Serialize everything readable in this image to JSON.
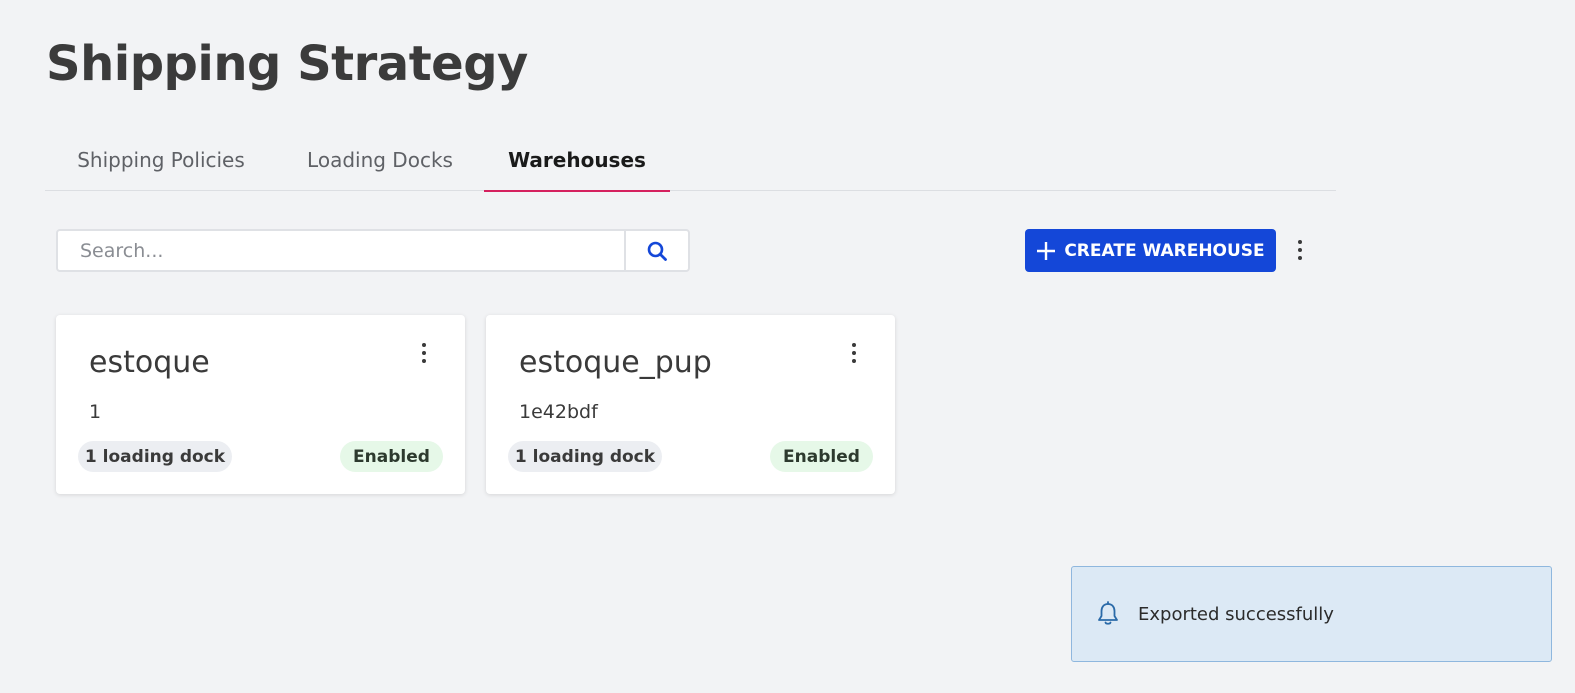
{
  "page": {
    "title": "Shipping Strategy"
  },
  "tabs": [
    {
      "label": "Shipping Policies",
      "active": false
    },
    {
      "label": "Loading Docks",
      "active": false
    },
    {
      "label": "Warehouses",
      "active": true
    }
  ],
  "toolbar": {
    "search_placeholder": "Search...",
    "create_label": "CREATE WAREHOUSE"
  },
  "warehouses": [
    {
      "name": "estoque",
      "code": "1",
      "docks": "1 loading dock",
      "status": "Enabled"
    },
    {
      "name": "estoque_pup",
      "code": "1e42bdf",
      "docks": "1 loading dock",
      "status": "Enabled"
    }
  ],
  "toast": {
    "message": "Exported successfully"
  },
  "colors": {
    "accent": "#1447d8",
    "tab_indicator": "#d5205e",
    "enabled_bg": "#e6f8e8",
    "toast_bg": "#dce9f5"
  },
  "icons": {
    "search": "search-icon",
    "plus": "plus-icon",
    "more": "more-vertical-icon",
    "bell": "bell-icon"
  }
}
